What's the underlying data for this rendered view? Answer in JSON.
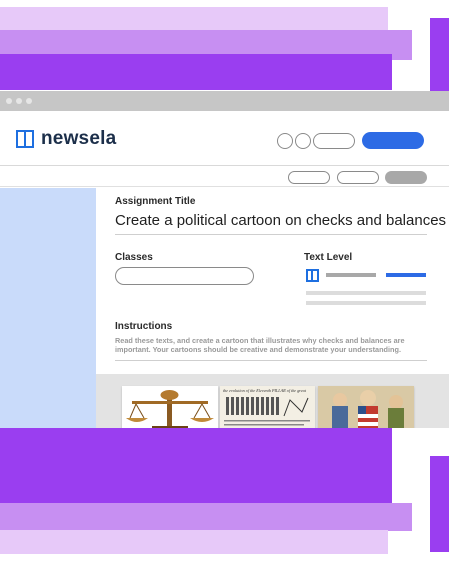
{
  "logo": {
    "text": "newsela",
    "icon": "newsela-logo-icon"
  },
  "colors": {
    "brand_blue": "#2d6be5",
    "purple_dark": "#9a3ef0",
    "purple_mid": "#c78ff2",
    "purple_light": "#e7c9f9",
    "sidebar_blue": "#c9dbfa"
  },
  "assignment": {
    "title_label": "Assignment Title",
    "title_value": "Create a political cartoon on checks and balances"
  },
  "classes": {
    "label": "Classes"
  },
  "text_level": {
    "label": "Text Level",
    "icon": "text-level-icon"
  },
  "instructions": {
    "label": "Instructions",
    "text": "Read these texts, and create a cartoon that illustrates why checks and balances are important. Your cartoons should be creative and demonstrate your understanding."
  },
  "gallery": {
    "thumbnails": [
      "scales-of-justice-image",
      "newspaper-clipping-image",
      "political-cartoon-image"
    ],
    "clipping_caption": "the evolution of the Eleventh PILLAR of the great"
  }
}
